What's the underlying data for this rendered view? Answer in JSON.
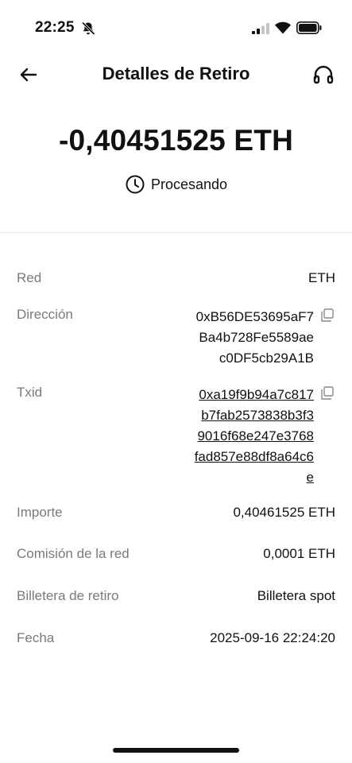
{
  "status_bar": {
    "time": "22:25"
  },
  "header": {
    "title": "Detalles de Retiro"
  },
  "summary": {
    "amount": "-0,40451525 ETH",
    "status": "Procesando"
  },
  "details": {
    "network": {
      "label": "Red",
      "value": "ETH"
    },
    "address": {
      "label": "Dirección",
      "lines": [
        "0xB56DE53695aF7",
        "Ba4b728Fe5589ae",
        "c0DF5cb29A1B"
      ]
    },
    "txid": {
      "label": "Txid",
      "lines": [
        "0xa19f9b94a7c817",
        "b7fab2573838b3f3",
        "9016f68e247e3768",
        "fad857e88df8a64c6",
        "e"
      ]
    },
    "amount": {
      "label": "Importe",
      "value": "0,40461525 ETH"
    },
    "fee": {
      "label": "Comisión de la red",
      "value": "0,0001 ETH"
    },
    "wallet": {
      "label": "Billetera de retiro",
      "value": "Billetera spot"
    },
    "date": {
      "label": "Fecha",
      "value": "2025-09-16 22:24:20"
    }
  },
  "colors": {
    "text": "#111111",
    "label": "#7a7a7a",
    "divider": "#e8e8e8"
  }
}
